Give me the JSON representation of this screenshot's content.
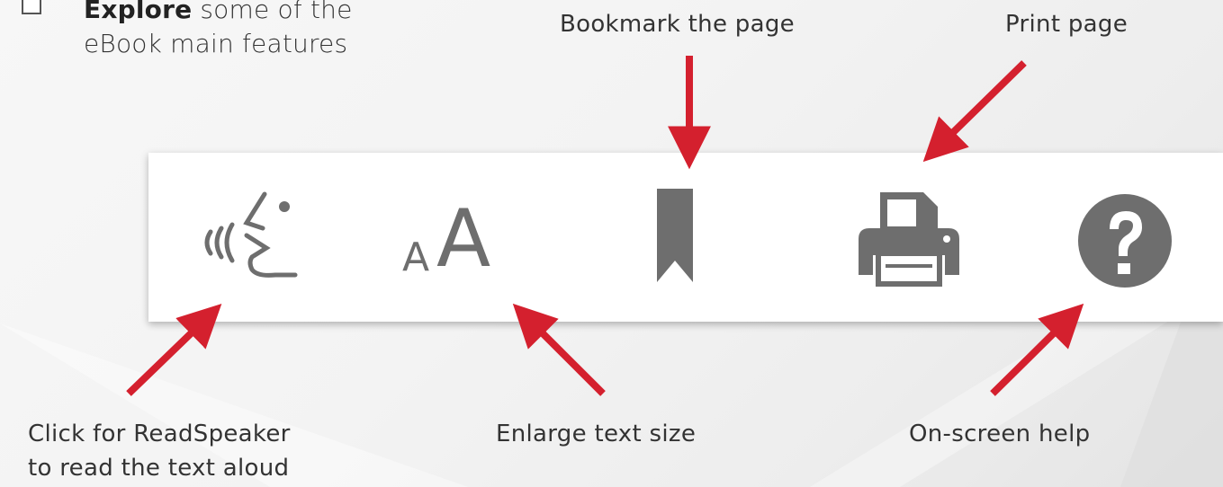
{
  "intro": {
    "bold": "Explore",
    "rest": " some of the",
    "line2": "eBook main features"
  },
  "labels": {
    "bookmark": "Bookmark the page",
    "print": "Print page",
    "readspeaker_line1": "Click for ReadSpeaker",
    "readspeaker_line2": "to read the text aloud",
    "enlarge": "Enlarge text size",
    "help": "On-screen help"
  },
  "toolbar": {
    "font_small": "A",
    "font_large": "A",
    "help_glyph": "?"
  },
  "icons": {
    "readspeaker": "readspeaker-icon",
    "text_size": "text-size-icon",
    "bookmark": "bookmark-icon",
    "print": "printer-icon",
    "help": "help-icon"
  },
  "colors": {
    "arrow": "#d4202e",
    "icon": "#6e6e6e",
    "toolbar_bg": "#ffffff"
  }
}
